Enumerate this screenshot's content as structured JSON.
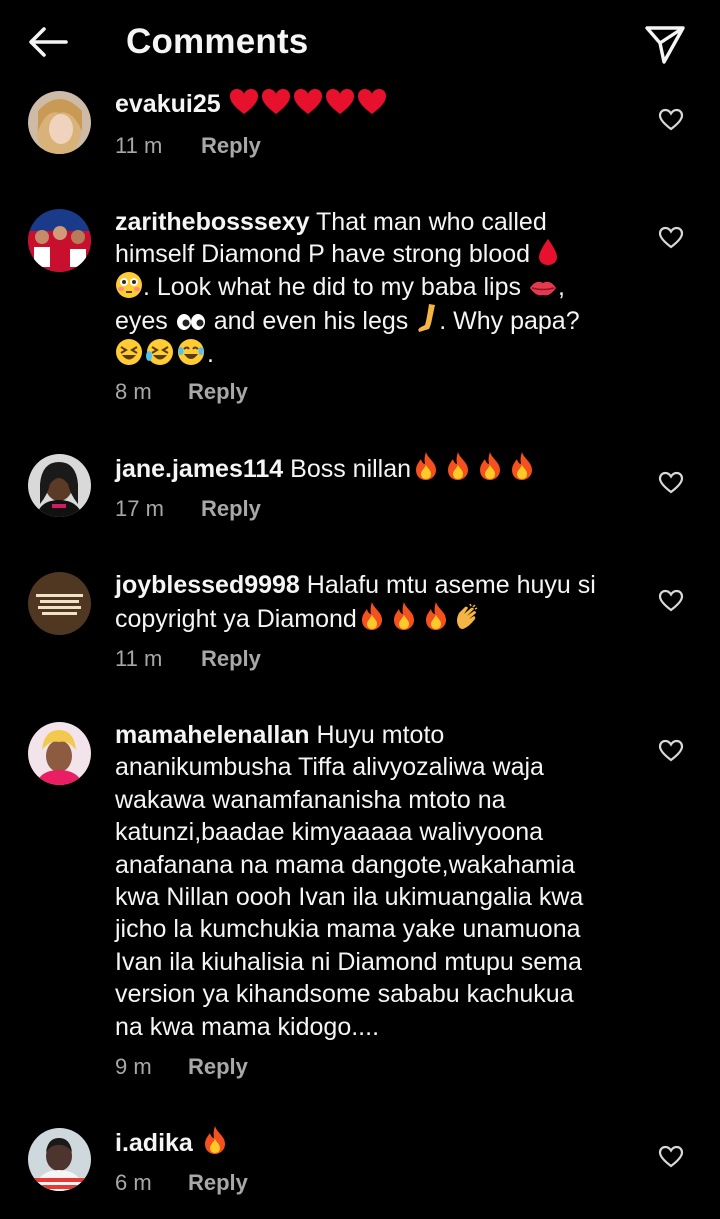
{
  "header": {
    "title": "Comments",
    "back_icon": "arrow-left-icon",
    "share_icon": "paper-plane-icon"
  },
  "comments": [
    {
      "username": "evakui25",
      "lines": [
        " "
      ],
      "emojis": [
        "heart",
        "heart",
        "heart",
        "heart",
        "heart"
      ],
      "time": "11 m",
      "reply_label": "Reply"
    },
    {
      "username": "zarithebosssexy",
      "lines": [
        " That man who called",
        "himself Diamond P have strong blood ",
        ". Look what he did to my baba lips ",
        "eyes ",
        " and even his legs ",
        ". Why papa?",
        "."
      ],
      "time": "8 m",
      "reply_label": "Reply"
    },
    {
      "username": "jane.james114",
      "lines": [
        " Boss nillan"
      ],
      "emojis": [
        "fire",
        "fire",
        "fire",
        "fire"
      ],
      "time": "17 m",
      "reply_label": "Reply"
    },
    {
      "username": "joyblessed9998",
      "lines": [
        " Halafu mtu aseme huyu si",
        "copyright ya Diamond"
      ],
      "emojis": [
        "fire",
        "fire",
        "fire",
        "clapping-hands"
      ],
      "time": "11 m",
      "reply_label": "Reply"
    },
    {
      "username": "mamahelenallan",
      "lines": [
        " Huyu mtoto",
        "ananikumbusha Tiffa alivyozaliwa waja",
        "wakawa wanamfananisha mtoto na",
        "katunzi,baadae kimyaaaaa walivyoona",
        "anafanana na mama dangote,wakahamia",
        "kwa Nillan oooh Ivan ila ukimuangalia kwa",
        "jicho la kumchukia mama yake unamuona",
        "Ivan ila kiuhalisia ni Diamond mtupu sema",
        "version ya kihandsome sababu kachukua",
        "na kwa mama kidogo...."
      ],
      "time": "9 m",
      "reply_label": "Reply"
    },
    {
      "username": "i.adika",
      "lines": [
        " "
      ],
      "emojis": [
        "fire"
      ],
      "time": "6 m",
      "reply_label": "Reply"
    }
  ],
  "colors": {
    "background": "#000000",
    "text": "#f5f5f5",
    "secondary_text": "#a8a8a8",
    "heart_emoji": "#e8112d",
    "fire_emoji": "#f4511e"
  }
}
